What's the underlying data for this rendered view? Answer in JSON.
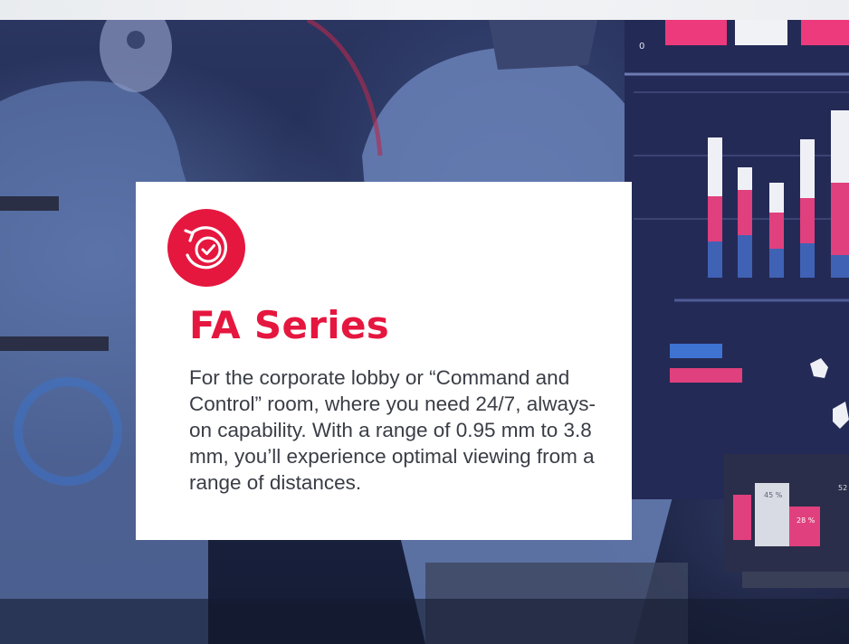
{
  "card": {
    "title": "FA Series",
    "description": "For the corporate lobby or “Command and Control” room, where you need 24/7, always-on capability. With a range of 0.95 mm to 3.8 mm, you’ll experience optimal viewing from a range of distances.",
    "icon": "check-cycle-icon",
    "accent_color": "#e5173f"
  },
  "background": {
    "screen_labels": [
      "0",
      "45 %",
      "28 %",
      "52"
    ]
  }
}
